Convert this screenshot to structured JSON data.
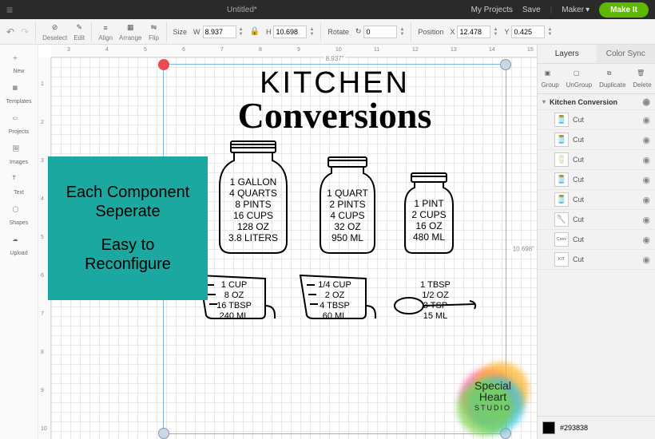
{
  "topbar": {
    "title": "Untitled*",
    "myprojects": "My Projects",
    "save": "Save",
    "maker": "Maker",
    "makeit": "Make It"
  },
  "toolbar": {
    "undo": "Undo",
    "redo": "Redo",
    "deselect": "Deselect",
    "edit": "Edit",
    "align": "Align",
    "arrange": "Arrange",
    "flip": "Flip",
    "size": "Size",
    "w": "W",
    "wval": "8.937",
    "h": "H",
    "hval": "10.698",
    "rotate": "Rotate",
    "rval": "0",
    "position": "Position",
    "x": "X",
    "xval": "12.478",
    "y": "Y",
    "yval": "0.425"
  },
  "lefttools": [
    "New",
    "Templates",
    "Projects",
    "Images",
    "Text",
    "Shapes",
    "Upload"
  ],
  "dims": {
    "w": "8.937\"",
    "h": "10.698\""
  },
  "design": {
    "title": "KITCHEN",
    "script": "Conversions",
    "jar1": [
      "1 GALLON",
      "4 QUARTS",
      "8 PINTS",
      "16 CUPS",
      "128 OZ",
      "3.8 LITERS"
    ],
    "jar2": [
      "1 QUART",
      "2 PINTS",
      "4 CUPS",
      "32 OZ",
      "950 ML"
    ],
    "jar3": [
      "1 PINT",
      "2 CUPS",
      "16 OZ",
      "480 ML"
    ],
    "cup1": [
      "1 CUP",
      "8 OZ",
      "16 TBSP",
      "240 ML"
    ],
    "cup2": [
      "1/4 CUP",
      "2 OZ",
      "4 TBSP",
      "60 ML"
    ],
    "spoon": [
      "1 TBSP",
      "1/2 OZ",
      "3 TSP",
      "15 ML"
    ]
  },
  "callout": {
    "l1": "Each Component",
    "l2": "Seperate",
    "l3": "Easy to",
    "l4": "Reconfigure"
  },
  "rpanel": {
    "layers": "Layers",
    "colorsync": "Color Sync",
    "group": "Group",
    "ungroup": "UnGroup",
    "duplicate": "Duplicate",
    "delete": "Delete",
    "project": "Kitchen Conversion",
    "cut": "Cut"
  },
  "logo": {
    "l1": "Special",
    "l2": "Heart",
    "l3": "STUDIO"
  },
  "colors": {
    "sw": "#000000",
    "hex": "#293838"
  }
}
